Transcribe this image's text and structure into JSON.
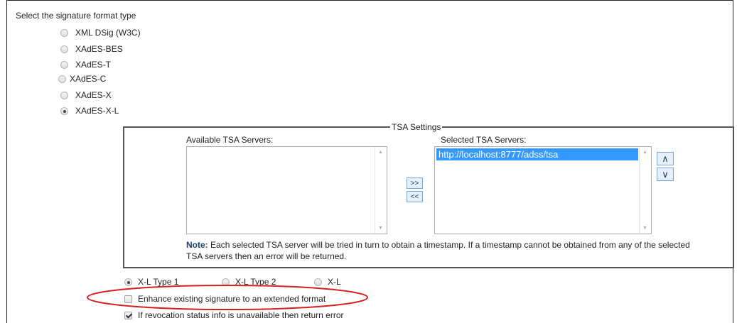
{
  "heading": "Select the signature format type",
  "formats": [
    {
      "label": "XML DSig (W3C)",
      "checked": false
    },
    {
      "label": "XAdES-BES",
      "checked": false
    },
    {
      "label": "XAdES-T",
      "checked": false
    },
    {
      "label": "XAdES-C",
      "checked": false
    },
    {
      "label": "XAdES-X",
      "checked": false
    },
    {
      "label": "XAdES-X-L",
      "checked": true
    }
  ],
  "tsa": {
    "legend": "TSA Settings",
    "available_label": "Available TSA Servers:",
    "selected_label": "Selected TSA Servers:",
    "selected_items": [
      "http://localhost:8777/adss/tsa"
    ],
    "add_button": ">>",
    "remove_button": "<<",
    "move_up": "∧",
    "move_down": "∨",
    "note_prefix": "Note:",
    "note_text": "Each selected TSA server will be tried in turn to obtain a timestamp. If a timestamp cannot be obtained from any of the selected TSA servers then an error will be returned."
  },
  "xl_types": [
    {
      "label": "X-L Type 1",
      "checked": true
    },
    {
      "label": "X-L Type 2",
      "checked": false
    },
    {
      "label": "X-L",
      "checked": false
    }
  ],
  "options": [
    {
      "label": "Enhance existing signature to an extended format",
      "checked": false
    },
    {
      "label": "If revocation status info is unavailable then return error",
      "checked": true
    }
  ],
  "colors": {
    "highlight_ellipse": "#d61f1f",
    "selected_option": "#3399ff",
    "button_border": "#7aa7d8"
  }
}
